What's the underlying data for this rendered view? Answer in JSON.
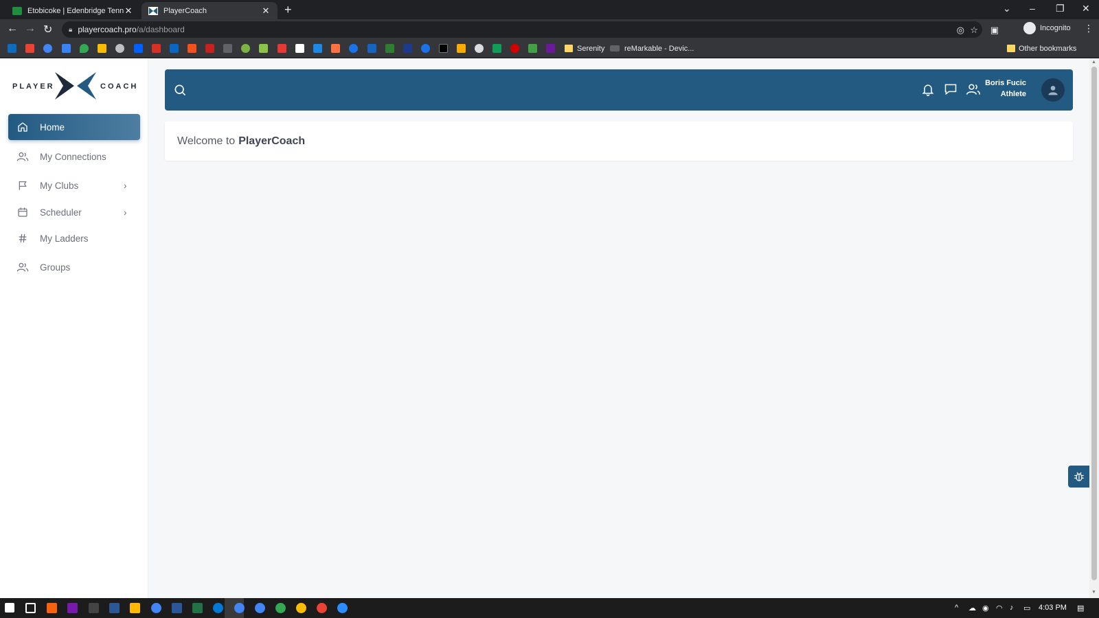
{
  "browser": {
    "tabs": [
      {
        "title": "Etobicoke | Edenbridge Tennis Cl",
        "icon": "spreadsheet-favicon"
      },
      {
        "title": "PlayerCoach",
        "icon": "playercoach-favicon"
      }
    ],
    "url_host": "playercoach.pro",
    "url_path": "/a/dashboard",
    "profile_label": "Incognito",
    "bookmarks": [
      "Serenity",
      "reMarkable - Devic...",
      "Other bookmarks"
    ]
  },
  "sidebar": {
    "logo_left": "PLAYER",
    "logo_right": "COACH",
    "items": [
      {
        "label": "Home",
        "icon": "home-icon",
        "active": true
      },
      {
        "label": "My Connections",
        "icon": "users-icon"
      },
      {
        "label": "My Clubs",
        "icon": "flag-icon",
        "chevron": true
      },
      {
        "label": "Scheduler",
        "icon": "calendar-icon",
        "chevron": true
      },
      {
        "label": "My Ladders",
        "icon": "hash-icon"
      },
      {
        "label": "Groups",
        "icon": "users-icon"
      }
    ]
  },
  "header": {
    "user_name": "Boris Fucic",
    "user_role": "Athlete"
  },
  "main": {
    "welcome_prefix": "Welcome to",
    "welcome_brand": "PlayerCoach"
  },
  "taskbar": {
    "clock": "4:03 PM"
  },
  "colors": {
    "brand_blue": "#235a82",
    "page_bg": "#f6f7f8"
  }
}
